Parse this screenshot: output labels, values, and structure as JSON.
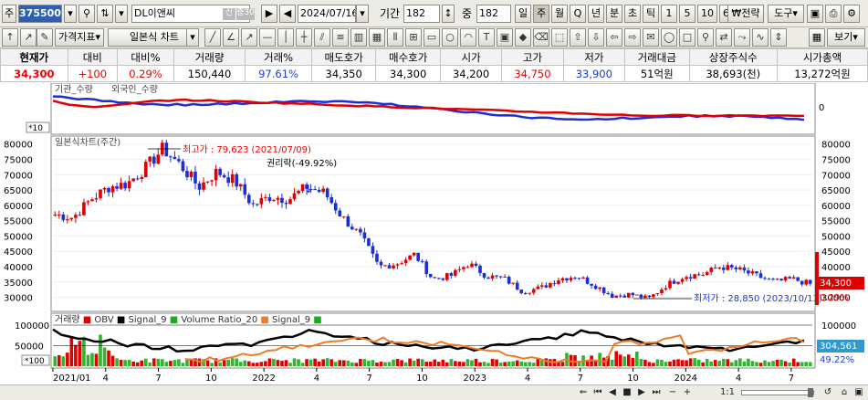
{
  "toolbar": {
    "market_label": "주",
    "stock_code": "375500",
    "stock_name": "DL이앤씨",
    "credit_badge": "신",
    "margin_badge": "증30",
    "date": "2024/07/16",
    "period_label": "기간",
    "period_value": "182",
    "center_label": "중",
    "center_value": "182",
    "intervals": [
      "일",
      "주",
      "월",
      "Q",
      "년",
      "분",
      "초",
      "틱",
      "1",
      "5",
      "10",
      "60"
    ],
    "selected_interval": "주",
    "strategy_label": "전략",
    "tools_label": "도구"
  },
  "toolbar2": {
    "price_indicator_label": "가격지표",
    "chart_type_label": "일본식 차트",
    "view_label": "보기"
  },
  "quote": {
    "headers": [
      "현재가",
      "대비",
      "대비%",
      "거래량",
      "거래%",
      "매도호가",
      "매수호가",
      "시가",
      "고가",
      "저가",
      "거래대금",
      "상장주식수",
      "시가총액"
    ],
    "values": [
      "34,300",
      "+100",
      "0.29%",
      "150,440",
      "97.61%",
      "34,350",
      "34,300",
      "34,200",
      "34,750",
      "33,900",
      "51억원",
      "38,693(천)",
      "13,272억원"
    ]
  },
  "chart_data": [
    {
      "type": "line",
      "title": "기관_수량",
      "series": [
        {
          "name": "기관_수량",
          "color": "#1c2ed8"
        },
        {
          "name": "외국인_수량",
          "color": "#e00000"
        }
      ],
      "right_ticks": [
        "0"
      ],
      "unit_label": "*10"
    },
    {
      "type": "candlestick",
      "title": "일본식차트(주간)",
      "ylim": [
        26000,
        82000
      ],
      "y_ticks": [
        30000,
        35000,
        40000,
        45000,
        50000,
        55000,
        60000,
        65000,
        70000,
        75000,
        80000
      ],
      "y_tick_labels": [
        "30000",
        "35000",
        "40000",
        "45000",
        "50000",
        "55000",
        "60000",
        "65000",
        "70000",
        "75000",
        "80000"
      ],
      "close_points": [
        [
          "2021/01",
          57000
        ],
        [
          "2021/02",
          56000
        ],
        [
          "2021/03",
          62000
        ],
        [
          "2021/04",
          66000
        ],
        [
          "2021/05",
          67000
        ],
        [
          "2021/06",
          72000
        ],
        [
          "2021/07",
          78500
        ],
        [
          "2021/08",
          73000
        ],
        [
          "2021/09",
          66000
        ],
        [
          "2021/10",
          71000
        ],
        [
          "2021/11",
          68000
        ],
        [
          "2021/12",
          60000
        ],
        [
          "2022/01",
          63000
        ],
        [
          "2022/02",
          62000
        ],
        [
          "2022/03",
          66000
        ],
        [
          "2022/04",
          64000
        ],
        [
          "2022/05",
          56000
        ],
        [
          "2022/06",
          50000
        ],
        [
          "2022/07",
          40000
        ],
        [
          "2022/08",
          41000
        ],
        [
          "2022/09",
          44000
        ],
        [
          "2022/10",
          36000
        ],
        [
          "2022/11",
          37000
        ],
        [
          "2022/12",
          41000
        ],
        [
          "2023/01",
          37000
        ],
        [
          "2023/02",
          36000
        ],
        [
          "2023/03",
          32000
        ],
        [
          "2023/04",
          33000
        ],
        [
          "2023/05",
          36000
        ],
        [
          "2023/06",
          37000
        ],
        [
          "2023/07",
          34000
        ],
        [
          "2023/08",
          30500
        ],
        [
          "2023/09",
          31000
        ],
        [
          "2023/10",
          29500
        ],
        [
          "2023/11",
          34000
        ],
        [
          "2023/12",
          37000
        ],
        [
          "2024/01",
          37500
        ],
        [
          "2024/02",
          40000
        ],
        [
          "2024/03",
          39000
        ],
        [
          "2024/04",
          37000
        ],
        [
          "2024/05",
          35000
        ],
        [
          "2024/06",
          36000
        ],
        [
          "2024/07",
          34300
        ]
      ],
      "annotations": {
        "high": "최고가 : 79,623 (2021/07/09)",
        "low": "최저가 : 28,850 (2023/10/13)",
        "rights": "권리락(-49.92%)"
      },
      "current_price_label": "34,300",
      "current_change_label": "0.29%"
    },
    {
      "type": "line",
      "title": "거래량",
      "legend": [
        {
          "name": "거래량",
          "color": "#e00000"
        },
        {
          "name": "OBV",
          "color": "#000000"
        },
        {
          "name": "Signal_9",
          "color": "#17b01b"
        },
        {
          "name": "Volume Ratio_20",
          "color": "#f07a28"
        },
        {
          "name": "Signal_9",
          "color": "#17b01b"
        }
      ],
      "y_ticks": [
        50000,
        100000
      ],
      "y_tick_labels": [
        "50000",
        "100000"
      ],
      "unit_label": "*100",
      "current_volume_label": "304,561",
      "current_ratio_label": "49.22%"
    }
  ],
  "x_axis": {
    "labels": [
      "2021/01",
      "4",
      "7",
      "10",
      "2022",
      "4",
      "7",
      "10",
      "2023",
      "4",
      "7",
      "10",
      "2024",
      "4",
      "7"
    ]
  },
  "colors": {
    "up": "#e00000",
    "down": "#1c2ed8",
    "accent": "#2f5fb0"
  },
  "footer": {
    "zoom_label": "1:1"
  }
}
